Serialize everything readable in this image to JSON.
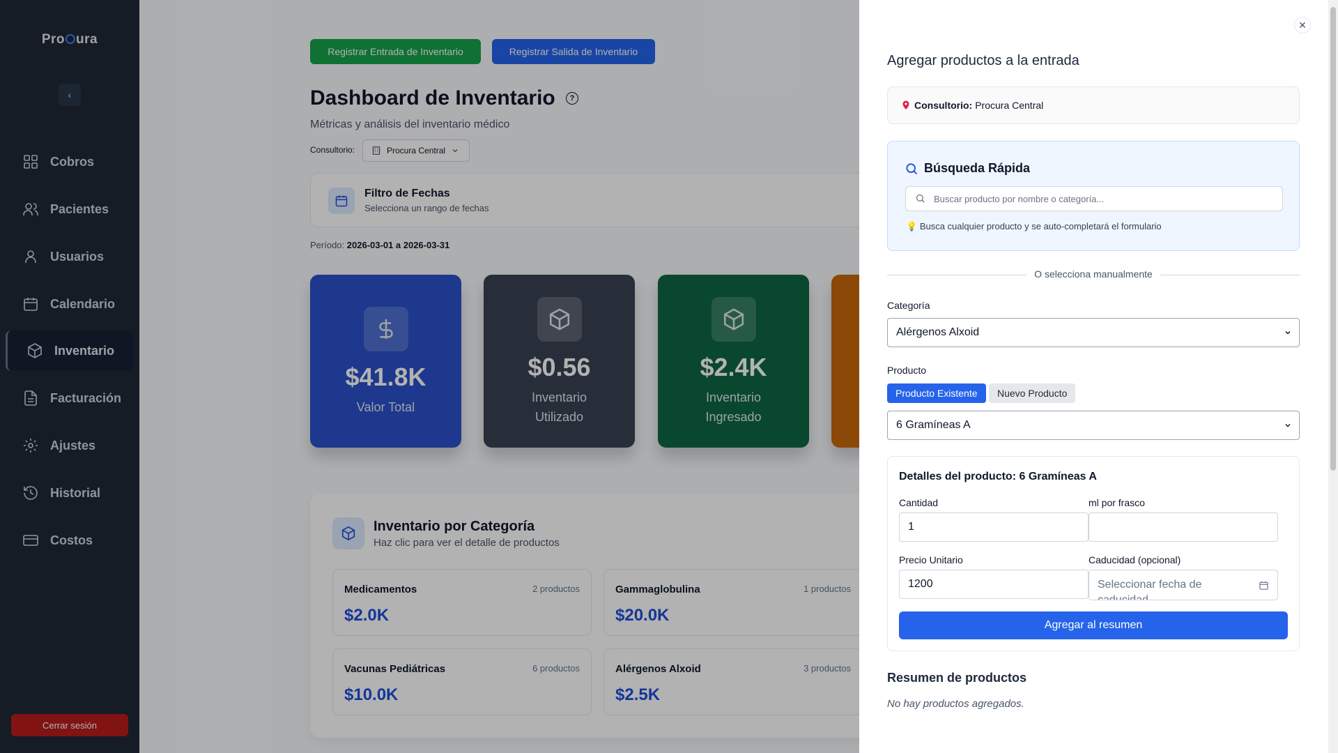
{
  "sidebar": {
    "logo": {
      "pre": "Pro",
      "post": "ura"
    },
    "items": [
      {
        "label": "Cobros",
        "icon": "grid-icon"
      },
      {
        "label": "Pacientes",
        "icon": "users-icon"
      },
      {
        "label": "Usuarios",
        "icon": "user-icon"
      },
      {
        "label": "Calendario",
        "icon": "calendar-icon"
      },
      {
        "label": "Inventario",
        "icon": "box-icon",
        "active": true
      },
      {
        "label": "Facturación",
        "icon": "file-icon"
      },
      {
        "label": "Ajustes",
        "icon": "gear-icon"
      },
      {
        "label": "Historial",
        "icon": "history-icon"
      },
      {
        "label": "Costos",
        "icon": "card-icon"
      }
    ],
    "logout_label": "Cerrar sesión"
  },
  "actions": {
    "entry_label": "Registrar Entrada de Inventario",
    "exit_label": "Registrar Salida de Inventario"
  },
  "dashboard": {
    "title": "Dashboard de Inventario",
    "subtitle": "Métricas y análisis del inventario médico",
    "consultorio_label": "Consultorio:",
    "consultorio_value": "Procura Central",
    "filter_title": "Filtro de Fechas",
    "filter_subtitle": "Selecciona un rango de fechas",
    "period_label": "Período:",
    "period_value": "2026-03-01 a 2026-03-31"
  },
  "kpis": [
    {
      "value": "$41.8K",
      "label": "Valor Total",
      "color": "#2a51c9"
    },
    {
      "value": "$0.56",
      "label": "Inventario Utilizado",
      "color": "#394354"
    },
    {
      "value": "$2.4K",
      "label": "Inventario Ingresado",
      "color": "#0e6643"
    }
  ],
  "categories": {
    "title": "Inventario por Categoría",
    "subtitle": "Haz clic para ver el detalle de productos",
    "items": [
      {
        "name": "Medicamentos",
        "count": "2 productos",
        "value": "$2.0K"
      },
      {
        "name": "Gammaglobulina",
        "count": "1 productos",
        "value": "$20.0K"
      },
      {
        "name": "Vacunas Pediátricas",
        "count": "6 productos",
        "value": "$10.0K"
      },
      {
        "name": "Alérgenos Alxoid",
        "count": "3 productos",
        "value": "$2.5K"
      }
    ]
  },
  "drawer": {
    "title": "Agregar productos a la entrada",
    "consultorio_label": "Consultorio:",
    "consultorio_value": "Procura Central",
    "search_title": "Búsqueda Rápida",
    "search_placeholder": "Buscar producto por nombre o categoría...",
    "search_hint": "Busca cualquier producto y se auto-completará el formulario",
    "divider_text": "O selecciona manualmente",
    "category_label": "Categoría",
    "category_value": "Alérgenos Alxoid",
    "product_label": "Producto",
    "toggle_existing": "Producto Existente",
    "toggle_new": "Nuevo Producto",
    "product_value": "6 Gramíneas A",
    "details_title": "Detalles del producto: 6 Gramíneas A",
    "qty_label": "Cantidad",
    "qty_value": "1",
    "ml_label": "ml por frasco",
    "ml_value": "",
    "price_label": "Precio Unitario",
    "price_value": "1200",
    "expiry_label": "Caducidad (opcional)",
    "expiry_placeholder": "Seleccionar fecha de caducidad",
    "add_button": "Agregar al resumen",
    "summary_title": "Resumen de productos",
    "summary_empty": "No hay productos agregados."
  }
}
